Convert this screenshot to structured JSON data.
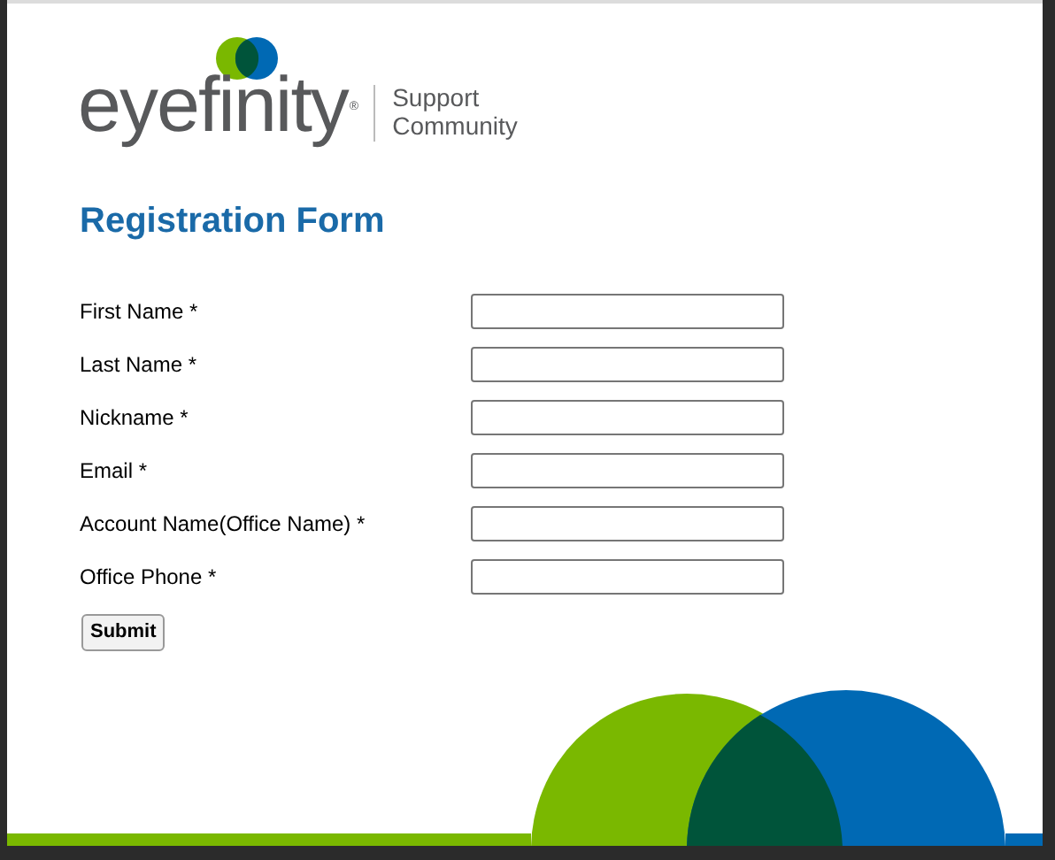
{
  "logo": {
    "wordmark": "eyefinity",
    "registered": "®",
    "tagline": [
      "Support",
      "Community"
    ]
  },
  "form": {
    "title": "Registration Form",
    "fields": [
      {
        "label": "First Name *"
      },
      {
        "label": "Last Name *"
      },
      {
        "label": "Nickname *"
      },
      {
        "label": "Email *"
      },
      {
        "label": "Account Name(Office Name) *"
      },
      {
        "label": "Office Phone *"
      }
    ],
    "submit": "Submit"
  }
}
